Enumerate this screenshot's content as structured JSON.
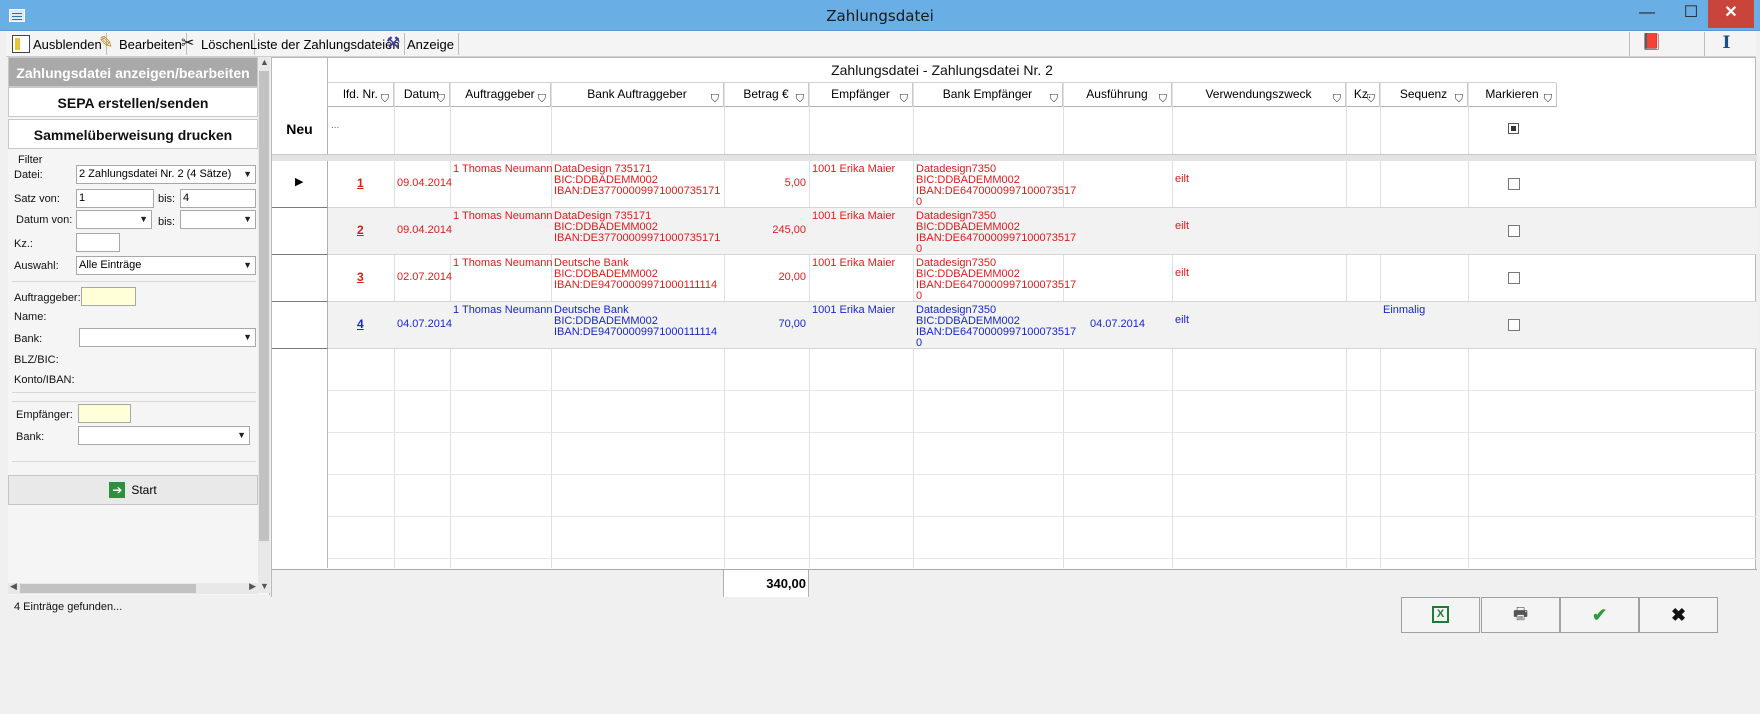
{
  "window": {
    "title": "Zahlungsdatei"
  },
  "toolbar": {
    "ausblenden": "Ausblenden",
    "bearbeiten": "Bearbeiten",
    "loeschen": "Löschen",
    "liste": "Liste der Zahlungsdateien",
    "anzeige": "Anzeige"
  },
  "sidebar": {
    "btn_anzeigen": "Zahlungsdatei anzeigen/bearbeiten",
    "btn_sepa": "SEPA erstellen/senden",
    "btn_druck": "Sammelüberweisung drucken",
    "filter": "Filter",
    "datei_label": "Datei:",
    "datei_value": "2  Zahlungsdatei Nr. 2 (4 Sätze)",
    "satz_von_label": "Satz von:",
    "satz_von_value": "1",
    "bis_label": "bis:",
    "satz_bis_value": "4",
    "datum_von_label": "Datum von:",
    "datum_bis_label": "bis:",
    "kz_label": "Kz.:",
    "auswahl_label": "Auswahl:",
    "auswahl_value": "Alle Einträge",
    "auftraggeber_label": "Auftraggeber:",
    "name_label": "Name:",
    "bank_label": "Bank:",
    "blz_label": "BLZ/BIC:",
    "konto_label": "Konto/IBAN:",
    "empfaenger_label": "Empfänger:",
    "bank2_label": "Bank:",
    "start": "Start"
  },
  "grid": {
    "title": "Zahlungsdatei - Zahlungsdatei Nr. 2",
    "columns": [
      "lfd. Nr.",
      "Datum",
      "Auftraggeber",
      "Bank Auftraggeber",
      "Betrag €",
      "Empfänger",
      "Bank Empfänger",
      "Ausführung",
      "Verwendungszweck",
      "Kz.",
      "Sequenz",
      "Markieren"
    ],
    "new_row_label": "Neu",
    "new_row_dots": "...",
    "rows": [
      {
        "nr": "1",
        "datum": "09.04.2014",
        "auftraggeber": "1 Thomas Neumann",
        "bank_auftraggeber": "DataDesign 735171\nBIC:DDBADEMM002\nIBAN:DE37700009971000735171",
        "betrag": "5,00",
        "empfaenger": "1001 Erika Maier",
        "bank_empfaenger": "Datadesign7350\nBIC:DDBADEMM002\nIBAN:DE6470000997100073517\n0",
        "ausfuehrung": "",
        "verwendungszweck": "eilt",
        "kz": "",
        "sequenz": "",
        "color": "#e01b1b"
      },
      {
        "nr": "2",
        "datum": "09.04.2014",
        "auftraggeber": "1 Thomas Neumann",
        "bank_auftraggeber": "DataDesign 735171\nBIC:DDBADEMM002\nIBAN:DE37700009971000735171",
        "betrag": "245,00",
        "empfaenger": "1001 Erika Maier",
        "bank_empfaenger": "Datadesign7350\nBIC:DDBADEMM002\nIBAN:DE6470000997100073517\n0",
        "ausfuehrung": "",
        "verwendungszweck": "eilt",
        "kz": "",
        "sequenz": "",
        "color": "#e01b1b"
      },
      {
        "nr": "3",
        "datum": "02.07.2014",
        "auftraggeber": "1 Thomas Neumann",
        "bank_auftraggeber": "Deutsche Bank\nBIC:DDBADEMM002\nIBAN:DE94700009971000111114",
        "betrag": "20,00",
        "empfaenger": "1001 Erika Maier",
        "bank_empfaenger": "Datadesign7350\nBIC:DDBADEMM002\nIBAN:DE6470000997100073517\n0",
        "ausfuehrung": "",
        "verwendungszweck": "eilt",
        "kz": "",
        "sequenz": "",
        "color": "#e01b1b"
      },
      {
        "nr": "4",
        "datum": "04.07.2014",
        "auftraggeber": "1 Thomas Neumann",
        "bank_auftraggeber": "Deutsche Bank\nBIC:DDBADEMM002\nIBAN:DE94700009971000111114",
        "betrag": "70,00",
        "empfaenger": "1001 Erika Maier",
        "bank_empfaenger": "Datadesign7350\nBIC:DDBADEMM002\nIBAN:DE6470000997100073517\n0",
        "ausfuehrung": "04.07.2014",
        "verwendungszweck": "eilt",
        "kz": "",
        "sequenz": "Einmalig",
        "color": "#1a28c8"
      }
    ],
    "sum": "340,00"
  },
  "status": {
    "text": "4 Einträge gefunden..."
  },
  "icons": [
    "app-icon",
    "minimize-icon",
    "maximize-icon",
    "close-icon",
    "hide-icon",
    "edit-icon",
    "delete-icon",
    "view-icon",
    "book-icon",
    "cursor-icon",
    "filter-icon",
    "arrow-right-icon",
    "excel-icon",
    "print-icon",
    "check-icon",
    "cancel-icon"
  ]
}
